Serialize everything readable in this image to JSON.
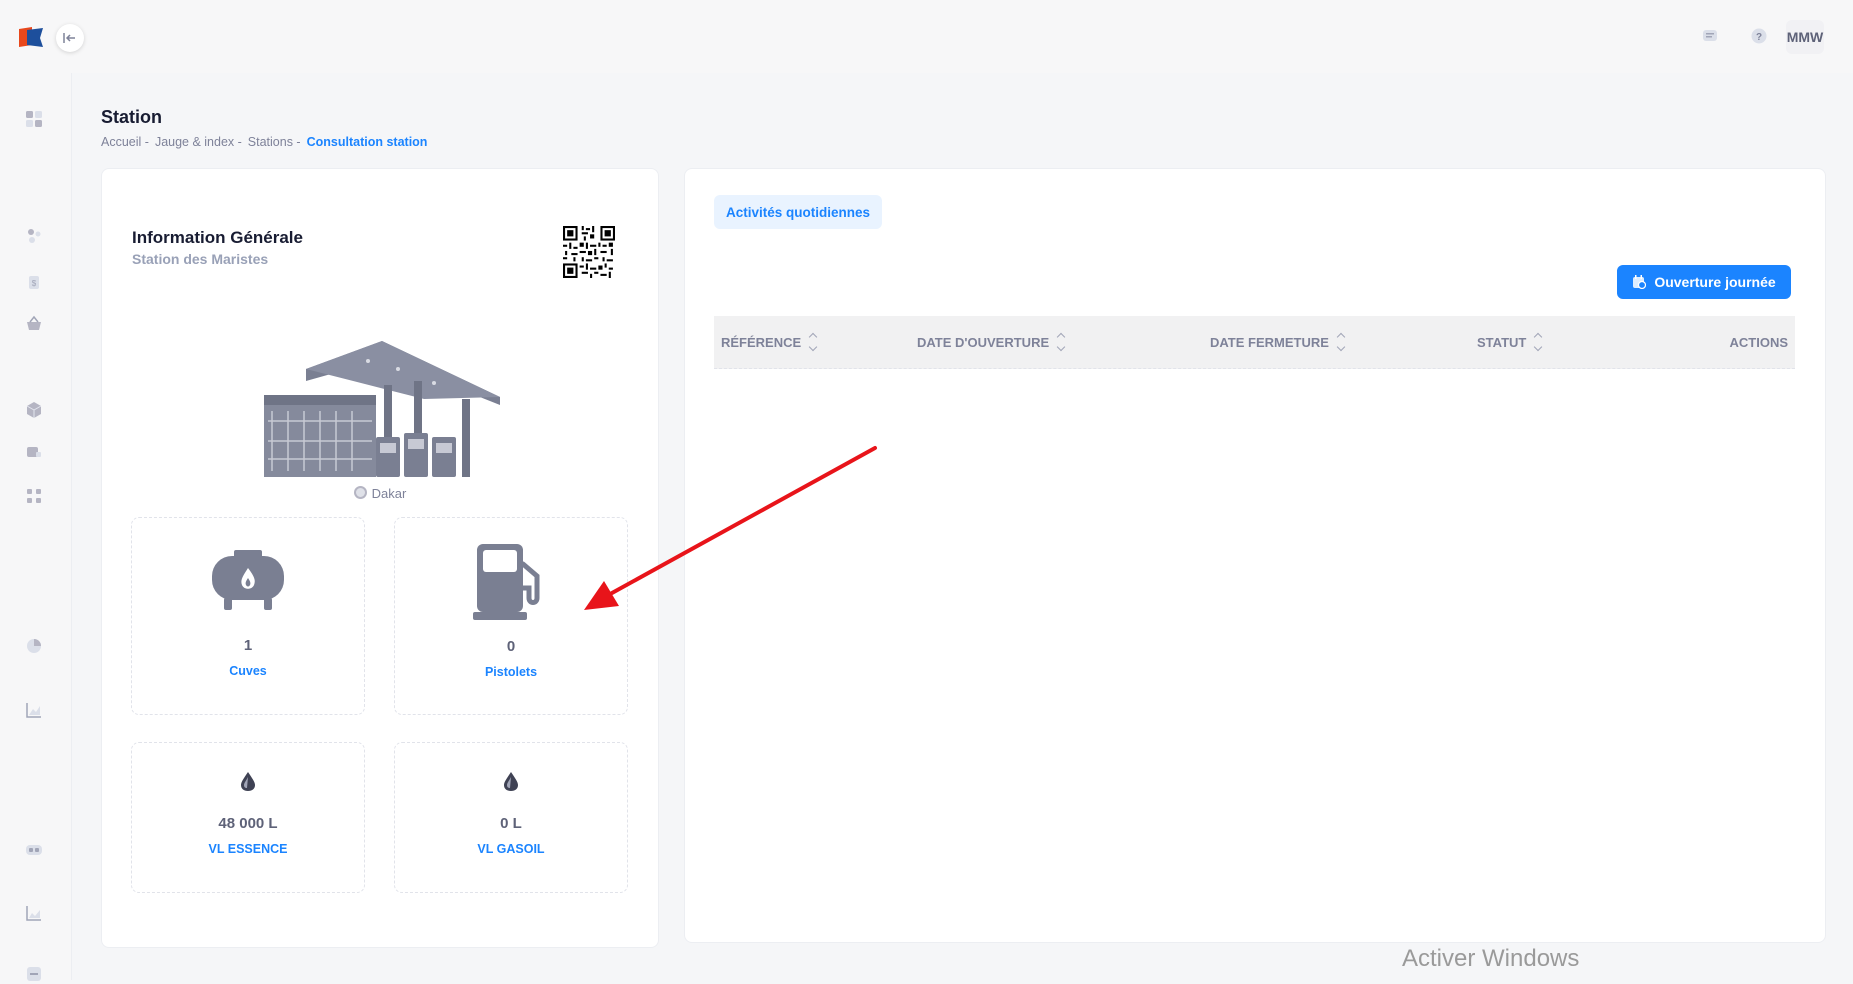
{
  "topbar": {
    "avatar_initials": "MMW",
    "icons": [
      "message-icon",
      "help-icon"
    ]
  },
  "sidebar": {
    "icons": [
      "dashboard-icon",
      "users-icon",
      "dollar-icon",
      "basket-icon",
      "box-icon",
      "truck-icon",
      "apps-icon",
      "pie-chart-icon",
      "bar-chart-icon",
      "toggle-icon",
      "line-chart-icon",
      "list-icon"
    ]
  },
  "page": {
    "title": "Station",
    "breadcrumb": [
      "Accueil -",
      "Jauge & index -",
      "Stations -",
      "Consultation station"
    ]
  },
  "info": {
    "title": "Information Générale",
    "subtitle": "Station des Maristes",
    "location": "Dakar"
  },
  "stats": [
    {
      "value": "1",
      "label": "Cuves",
      "icon": "tank-icon"
    },
    {
      "value": "0",
      "label": "Pistolets",
      "icon": "fuel-pump-icon"
    },
    {
      "value": "48 000 L",
      "label": "VL ESSENCE",
      "icon": "drop-icon"
    },
    {
      "value": "0 L",
      "label": "VL GASOIL",
      "icon": "drop-icon"
    }
  ],
  "activities": {
    "tab_label": "Activités quotidiennes",
    "open_button": "Ouverture journée",
    "columns": [
      "RÉFÉRENCE",
      "DATE D'OUVERTURE",
      "DATE FERMETURE",
      "STATUT",
      "ACTIONS"
    ],
    "rows": []
  },
  "watermark": "Activer Windows",
  "colors": {
    "accent": "#1b84ff",
    "annotation_arrow": "#e8141a"
  }
}
